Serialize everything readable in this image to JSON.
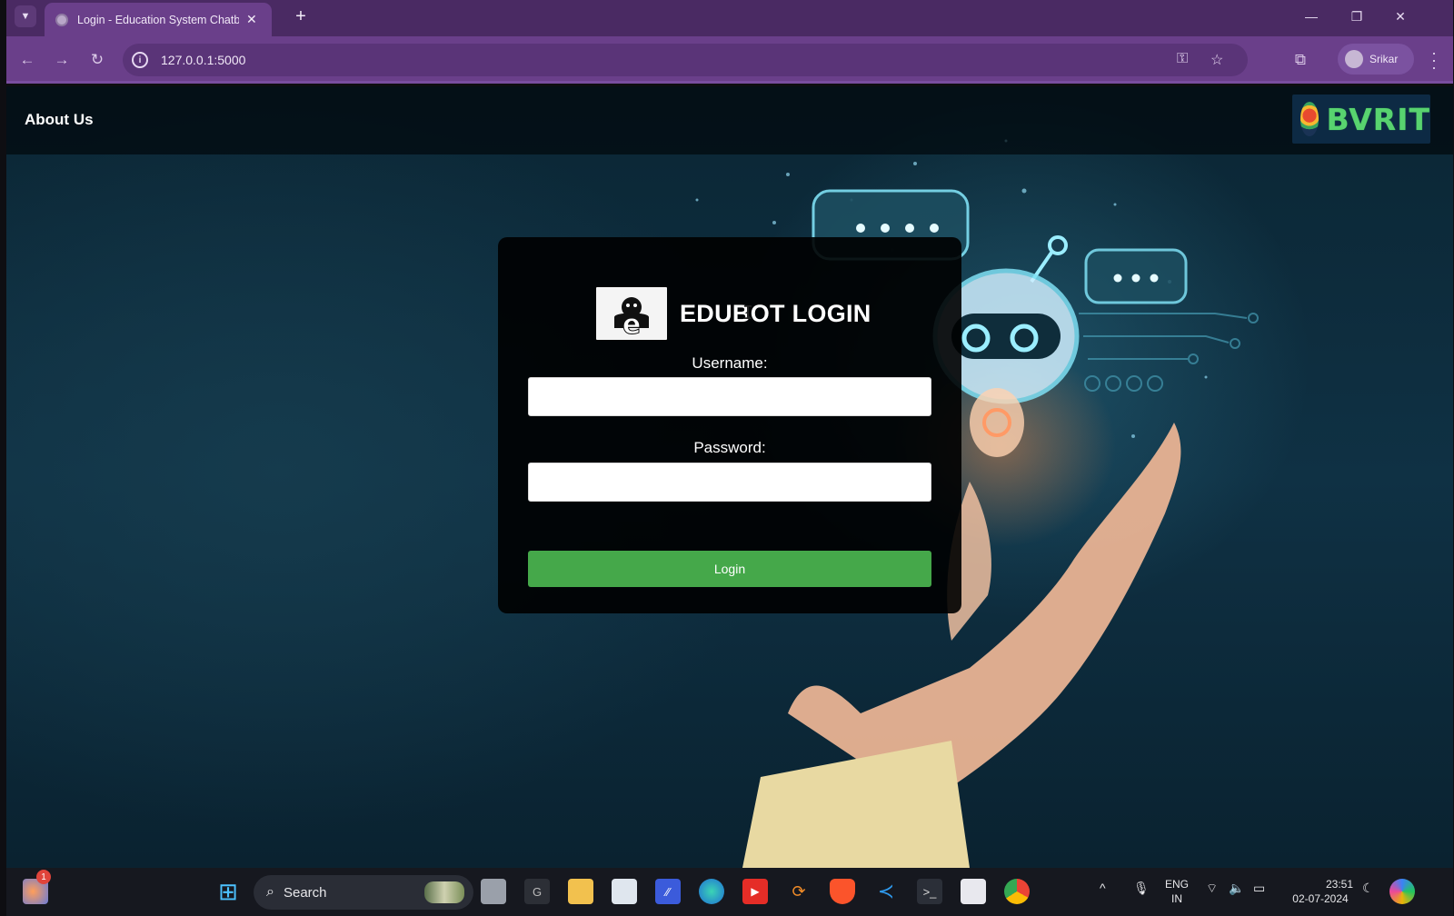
{
  "browser": {
    "tab_title": "Login - Education System Chatb",
    "tab_close": "✕",
    "new_tab": "+",
    "url": "127.0.0.1:5000",
    "profile_name": "Srikar",
    "window_controls": {
      "minimize": "—",
      "restore": "❐",
      "close": "✕"
    }
  },
  "page": {
    "nav": {
      "about_label": "About Us"
    },
    "logo_text": "BVRIT",
    "login": {
      "heading": "EDUBOT LOGIN",
      "username_label": "Username:",
      "username_value": "",
      "password_label": "Password:",
      "password_value": "",
      "submit_label": "Login"
    },
    "colors": {
      "primary_button": "#45a84a",
      "browser_chrome": "#6a3f8a",
      "card_bg": "#000000"
    }
  },
  "taskbar": {
    "search_placeholder": "Search",
    "notification_count": "1",
    "language": "ENG",
    "region": "IN",
    "time": "23:51",
    "date": "02-07-2024"
  }
}
